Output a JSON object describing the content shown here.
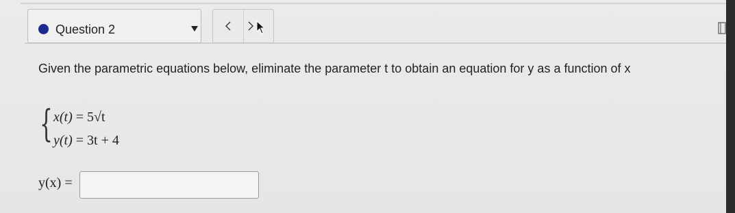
{
  "question_nav": {
    "question_label": "Question 2",
    "status_color": "#1d2a8f",
    "prev_glyph": "<",
    "next_glyph": ">"
  },
  "question": {
    "prompt": "Given the parametric equations below, eliminate the parameter t to obtain an equation for y as a function of x",
    "equations": [
      {
        "lhs": "x(t)",
        "rhs": "5√t"
      },
      {
        "lhs": "y(t)",
        "rhs": "3t + 4"
      }
    ]
  },
  "answer": {
    "label": "y(x) =",
    "value": "",
    "placeholder": ""
  },
  "icons": {
    "status": "status-dot-icon",
    "dropdown": "dropdown-arrow-icon",
    "prev": "chevron-left-icon",
    "next": "chevron-right-icon",
    "cursor": "mouse-cursor-icon",
    "corner": "sidebar-toggle-icon"
  }
}
